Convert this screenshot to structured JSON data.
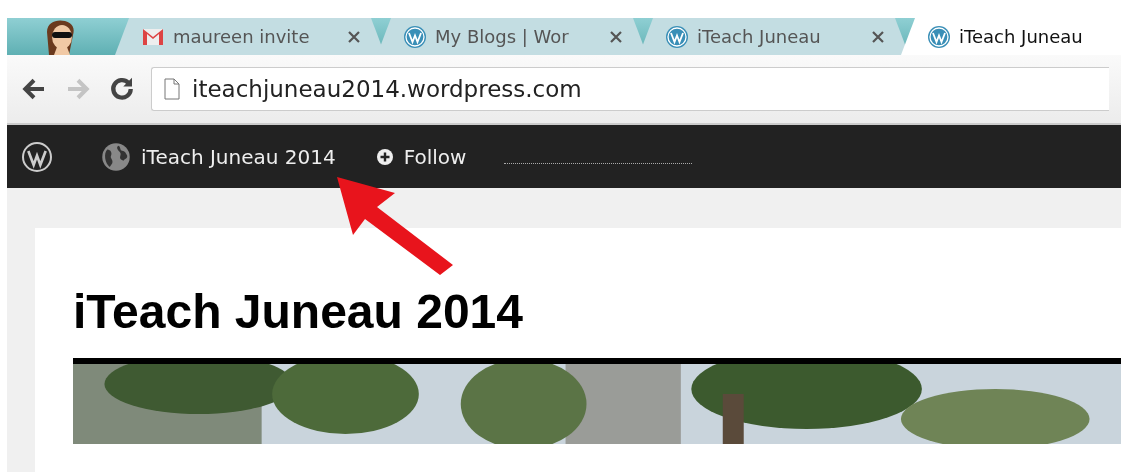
{
  "browser": {
    "tabs": [
      {
        "title": "maureen invite",
        "kind": "mail",
        "selected": false
      },
      {
        "title": "My Blogs | Wor",
        "kind": "wordpress",
        "selected": false
      },
      {
        "title": "iTeach Juneau",
        "kind": "wordpress",
        "selected": false
      },
      {
        "title": "iTeach Juneau",
        "kind": "wordpress",
        "selected": true
      }
    ],
    "nav": [
      {
        "kind": "back",
        "disabled": false
      },
      {
        "kind": "forward",
        "disabled": true
      },
      {
        "kind": "reload",
        "disabled": false
      }
    ],
    "address": "iteachjuneau2014.wordpress.com"
  },
  "admin_bar": {
    "site": "iTeach Juneau 2014",
    "follow": "Follow"
  },
  "page": {
    "title": "iTeach Juneau 2014"
  },
  "annotation": {
    "kind": "arrow"
  }
}
